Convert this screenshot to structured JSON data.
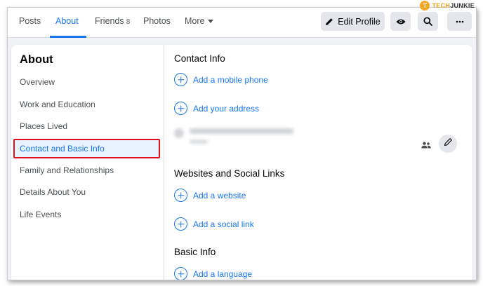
{
  "nav": {
    "tabs": [
      {
        "label": "Posts"
      },
      {
        "label": "About"
      },
      {
        "label": "Friends",
        "count": "8"
      },
      {
        "label": "Photos"
      },
      {
        "label": "More"
      }
    ],
    "active_tab": "About",
    "edit_profile_label": "Edit Profile",
    "icons": [
      "pencil-icon",
      "eye-icon",
      "search-icon",
      "ellipsis-icon"
    ]
  },
  "watermark": {
    "logo_letter": "T",
    "text_part1": "TECH",
    "text_part2": "JUNKIE"
  },
  "sidebar": {
    "title": "About",
    "items": [
      {
        "label": "Overview"
      },
      {
        "label": "Work and Education"
      },
      {
        "label": "Places Lived"
      },
      {
        "label": "Contact and Basic Info",
        "active": true
      },
      {
        "label": "Family and Relationships"
      },
      {
        "label": "Details About You"
      },
      {
        "label": "Life Events"
      }
    ]
  },
  "main": {
    "contact_info_title": "Contact Info",
    "add_mobile": "Add a mobile phone",
    "add_address": "Add your address",
    "websites_title": "Websites and Social Links",
    "add_website": "Add a website",
    "add_social": "Add a social link",
    "basic_info_title": "Basic Info",
    "add_language": "Add a language"
  },
  "colors": {
    "accent": "#1877f2",
    "highlight_border": "#e0101d",
    "active_bg": "#e7f3ff"
  }
}
